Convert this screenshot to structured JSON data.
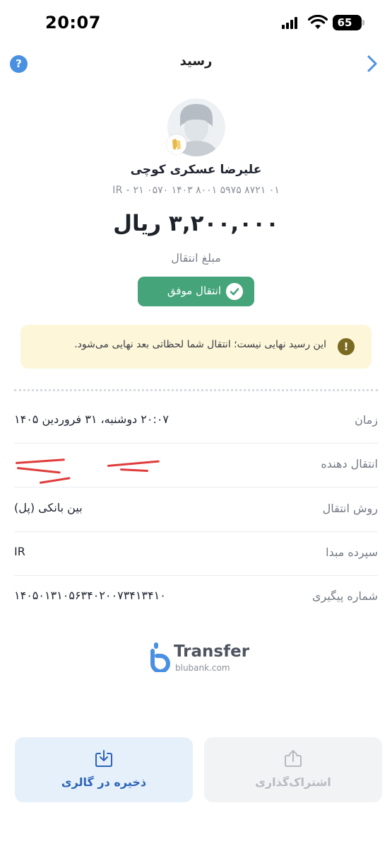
{
  "status_bar": {
    "time": "20:07",
    "battery": "65"
  },
  "header": {
    "title": "رسید",
    "help_icon": "question-icon",
    "back_icon": "chevron-right-icon"
  },
  "recipient": {
    "name": "علیرضا عسکری کوچی",
    "iban": "IR - ۲۱ ۰۵۷۰ ۱۴۰۳ ۸۰۰۱ ۵۹۷۵ ۸۷۲۱ ۰۱"
  },
  "amount": {
    "value": "۳,۲۰۰,۰۰۰ ریال",
    "label": "مبلغ انتقال"
  },
  "status": {
    "label": "انتقال موفق",
    "color": "#45a47a"
  },
  "warning": {
    "text": "این رسید نهایی نیست؛ انتقال شما لحظاتی بعد نهایی می‌شود.",
    "background": "#fdf6d9"
  },
  "details": [
    {
      "label": "زمان",
      "value": "۲۰:۰۷ دوشنبه، ۳۱ فروردین ۱۴۰۵"
    },
    {
      "label": "انتقال دهنده",
      "value": ""
    },
    {
      "label": "روش انتقال",
      "value": "بین بانکی (پل)"
    },
    {
      "label": "سپرده مبدا",
      "value": "IR"
    },
    {
      "label": "شماره پیگیری",
      "value": "۱۴۰۵۰۱۳۱۰۵۶۳۴۰۲۰۰۷۳۴۱۳۴۱۰"
    }
  ],
  "brand": {
    "word": "Transfer",
    "sub": "blubank.com",
    "accent": "#4a90e2"
  },
  "actions": {
    "save": {
      "label": "ذخیره در گالری",
      "icon": "download-icon"
    },
    "share": {
      "label": "اشتراک‌گذاری",
      "icon": "share-icon"
    }
  }
}
